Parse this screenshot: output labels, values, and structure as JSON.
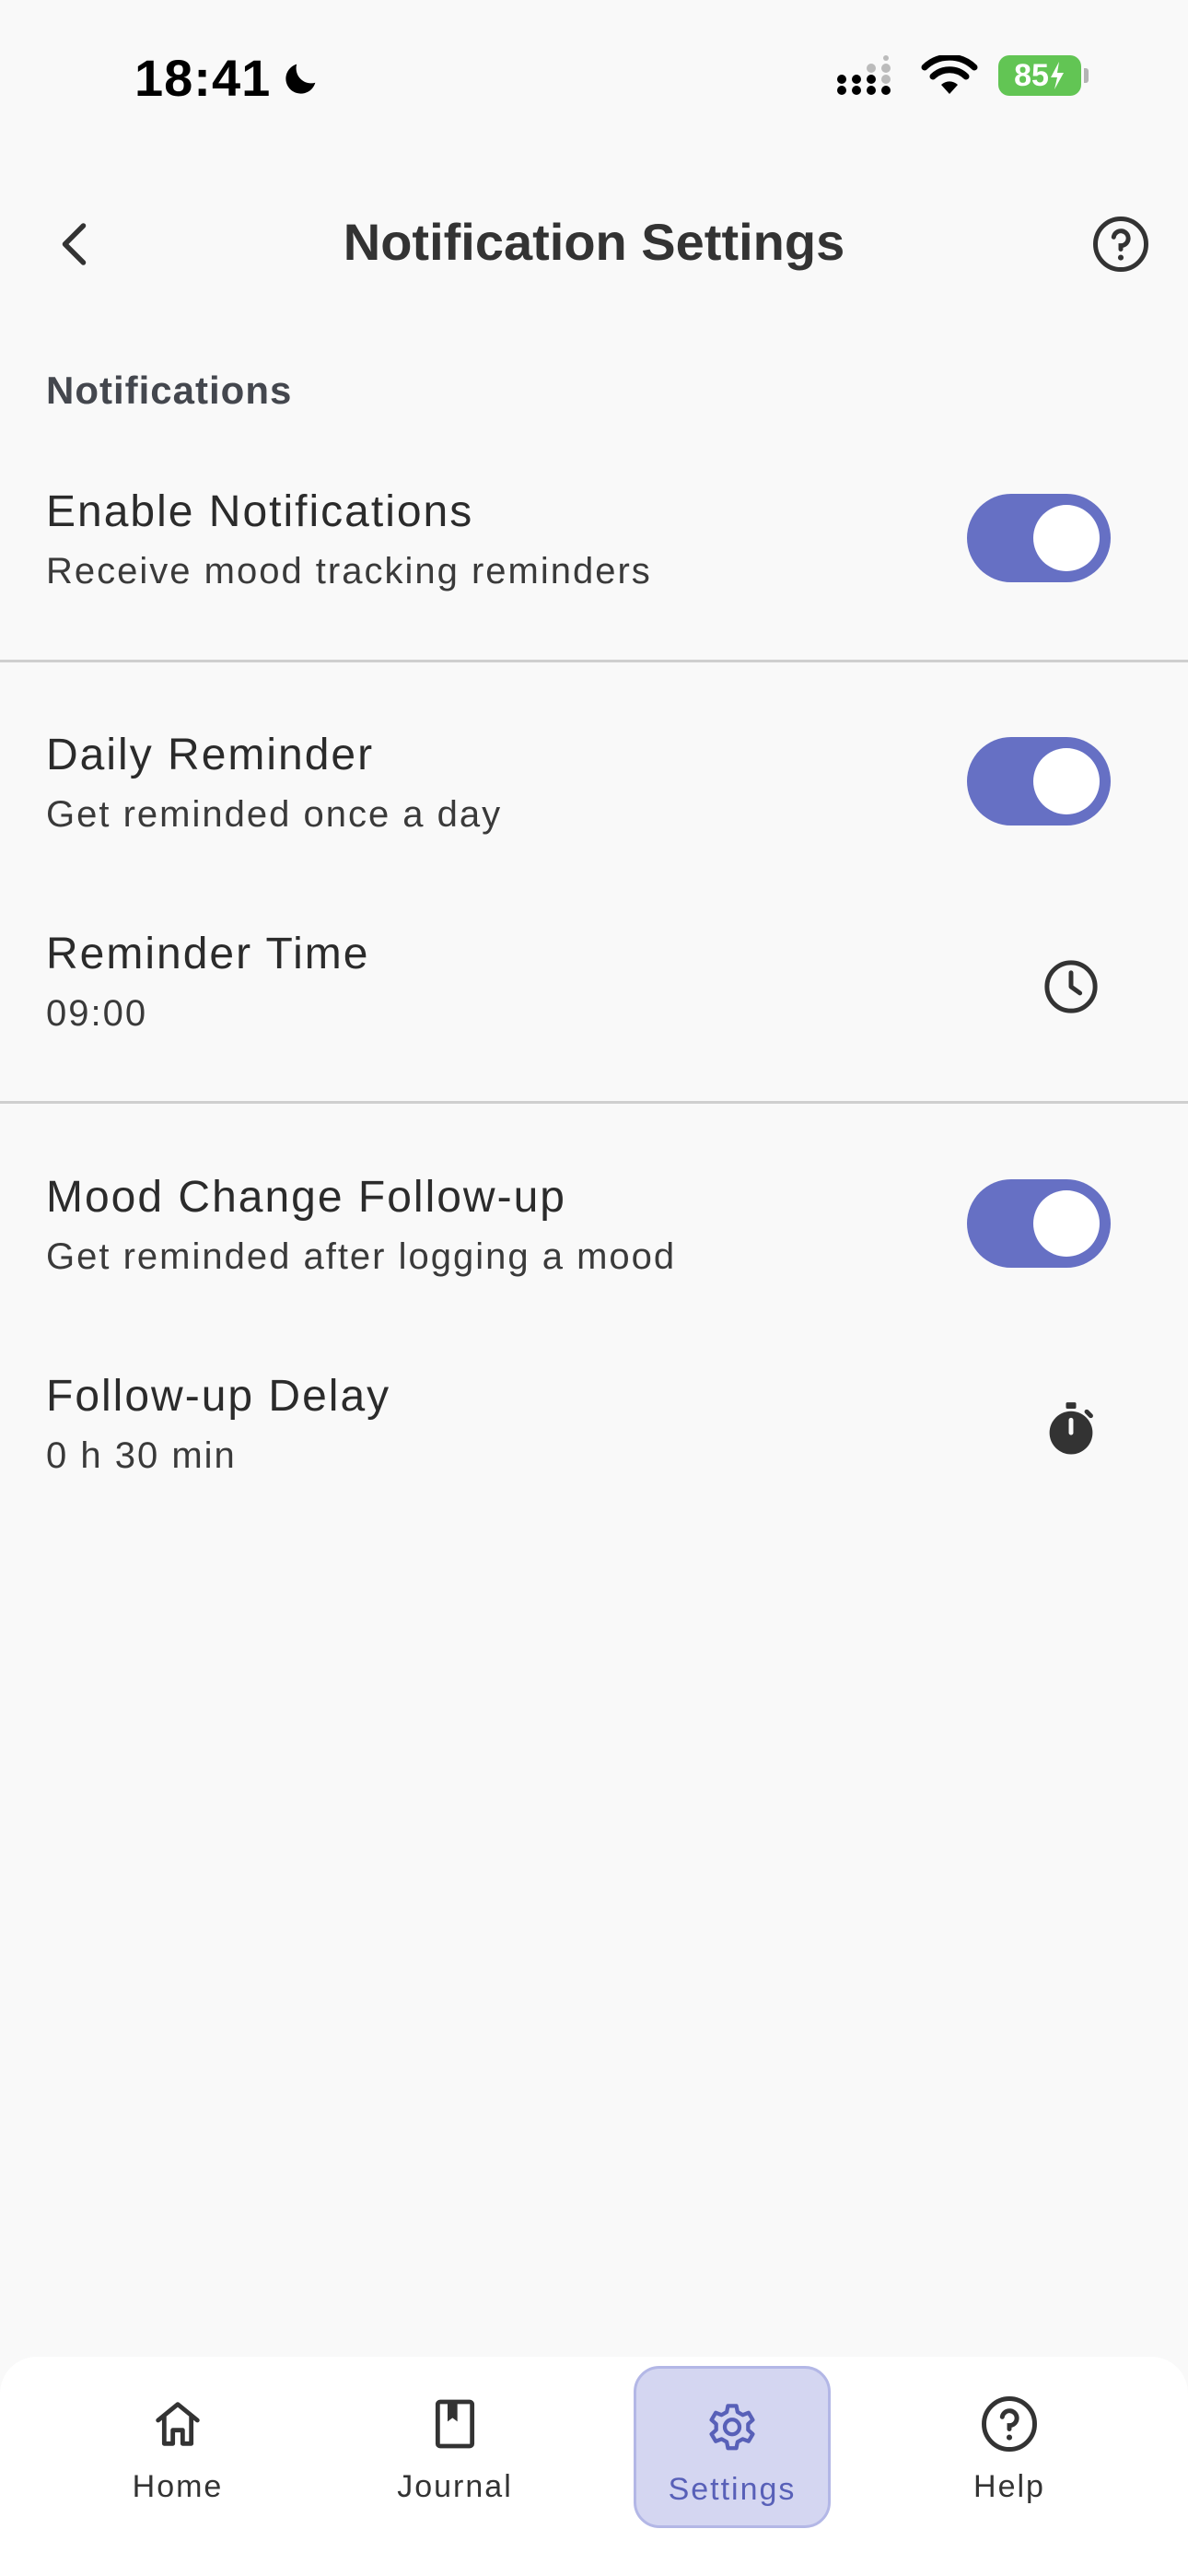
{
  "status_bar": {
    "time": "18:41",
    "battery": "85"
  },
  "header": {
    "title": "Notification Settings"
  },
  "section": {
    "title": "Notifications"
  },
  "rows": {
    "enable_notifications": {
      "title": "Enable Notifications",
      "subtitle": "Receive mood tracking reminders",
      "enabled": true
    },
    "daily_reminder": {
      "title": "Daily Reminder",
      "subtitle": "Get reminded once a day",
      "enabled": true
    },
    "reminder_time": {
      "title": "Reminder Time",
      "value": "09:00",
      "icon": "clock-icon"
    },
    "mood_followup": {
      "title": "Mood Change Follow-up",
      "subtitle": "Get reminded after logging a mood",
      "enabled": true
    },
    "followup_delay": {
      "title": "Follow-up Delay",
      "value": "0 h 30 min",
      "icon": "timer-icon"
    }
  },
  "nav": {
    "items": [
      {
        "label": "Home",
        "icon": "home-icon"
      },
      {
        "label": "Journal",
        "icon": "journal-icon"
      },
      {
        "label": "Settings",
        "icon": "gear-icon",
        "active": true
      },
      {
        "label": "Help",
        "icon": "help-icon"
      }
    ]
  },
  "colors": {
    "accent": "#6670c4",
    "nav_active_bg": "#d4d6f1",
    "background": "#f9f9f9"
  }
}
